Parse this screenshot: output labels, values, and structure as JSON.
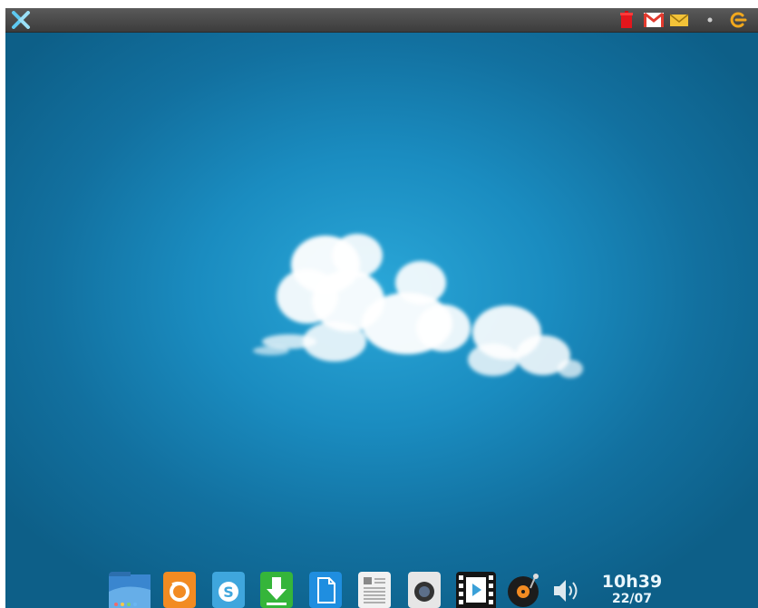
{
  "topbar": {
    "icons": [
      "app-menu-x-icon",
      "trash-icon",
      "gmail-icon",
      "mail-icon",
      "dot-icon",
      "power-icon"
    ]
  },
  "dock": {
    "apps": [
      "file-manager-icon",
      "firefox-icon",
      "skype-icon",
      "download-icon",
      "document-icon",
      "text-editor-icon",
      "webcam-icon",
      "video-player-icon",
      "music-player-icon",
      "volume-icon"
    ]
  },
  "clock": {
    "time": "10h39",
    "date": "22/07"
  },
  "colors": {
    "desktop": "#1a8cc0",
    "topbar": "#4a4a4a",
    "accent_orange": "#f2a81d",
    "clock_text": "#e9f6fc"
  }
}
